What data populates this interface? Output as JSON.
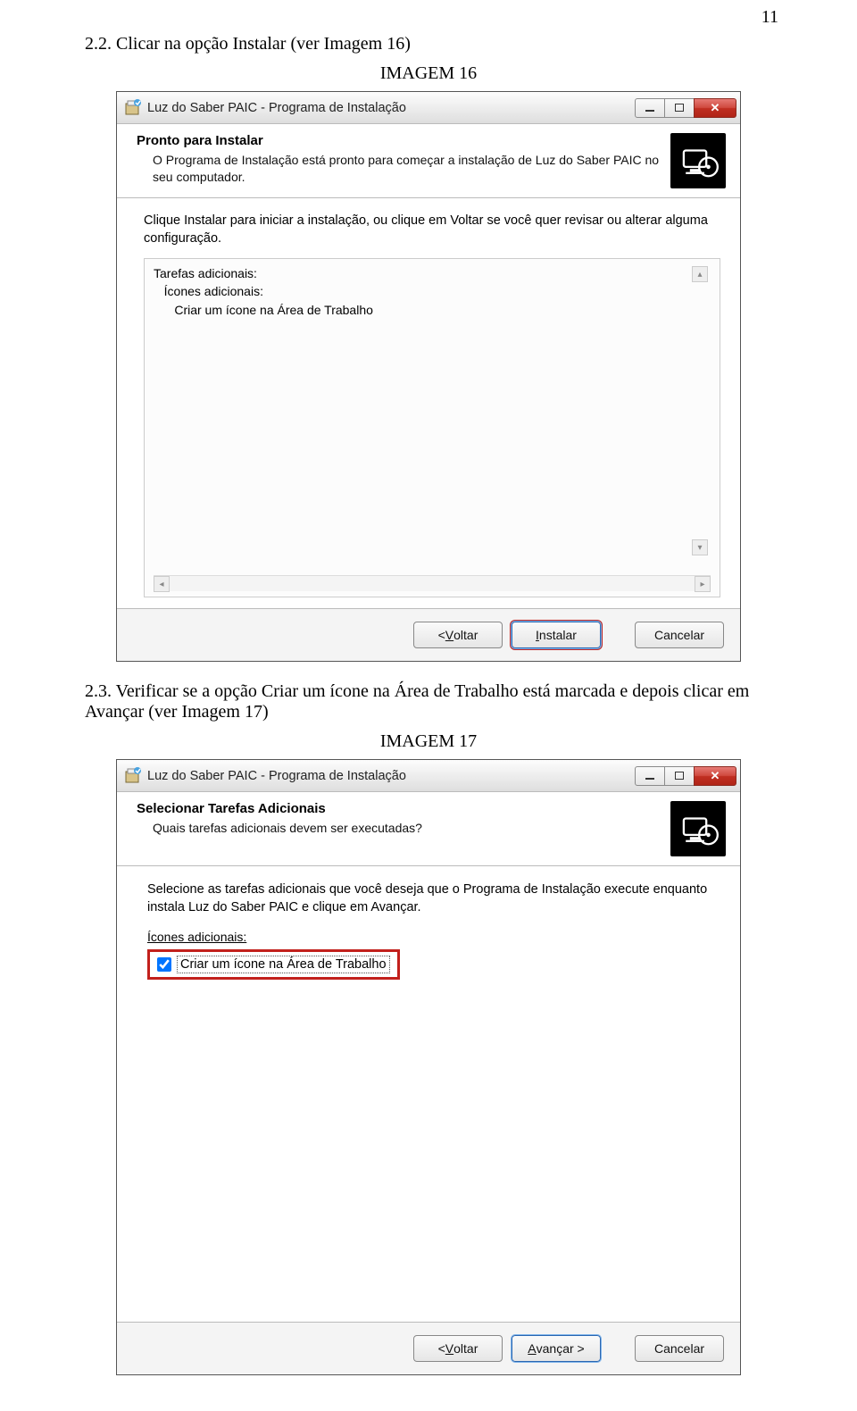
{
  "page_number": "11",
  "doc": {
    "step22": "2.2. Clicar na opção Instalar (ver Imagem 16)",
    "caption16": "IMAGEM 16",
    "step23": "2.3. Verificar se a opção Criar um ícone na Área de Trabalho está marcada e depois clicar em Avançar (ver Imagem 17)",
    "caption17": "IMAGEM 17"
  },
  "dialog1": {
    "title": "Luz do Saber PAIC - Programa de Instalação",
    "header_main": "Pronto para Instalar",
    "header_sub": "O Programa de Instalação está pronto para começar a instalação de Luz do Saber PAIC no seu computador.",
    "intro": "Clique Instalar para iniciar a instalação, ou clique em Voltar se você quer revisar ou alterar alguma configuração.",
    "summary_lines": [
      "Tarefas adicionais:",
      "   Ícones adicionais:",
      "      Criar um ícone na Área de Trabalho"
    ],
    "btn_back_prefix": "< ",
    "btn_back_ul": "V",
    "btn_back_rest": "oltar",
    "btn_install_ul": "I",
    "btn_install_rest": "nstalar",
    "btn_cancel": "Cancelar"
  },
  "dialog2": {
    "title": "Luz do Saber PAIC - Programa de Instalação",
    "header_main": "Selecionar Tarefas Adicionais",
    "header_sub": "Quais tarefas adicionais devem ser executadas?",
    "intro": "Selecione as tarefas adicionais que você deseja que o Programa de Instalação execute enquanto instala Luz do Saber PAIC e clique em Avançar.",
    "section_label": "Ícones adicionais:",
    "checkbox_pre": "Criar um ícone na Área de ",
    "checkbox_ul": "T",
    "checkbox_post": "rabalho",
    "btn_back_prefix": "< ",
    "btn_back_ul": "V",
    "btn_back_rest": "oltar",
    "btn_next_ul": "A",
    "btn_next_rest": "vançar >",
    "btn_cancel": "Cancelar"
  }
}
